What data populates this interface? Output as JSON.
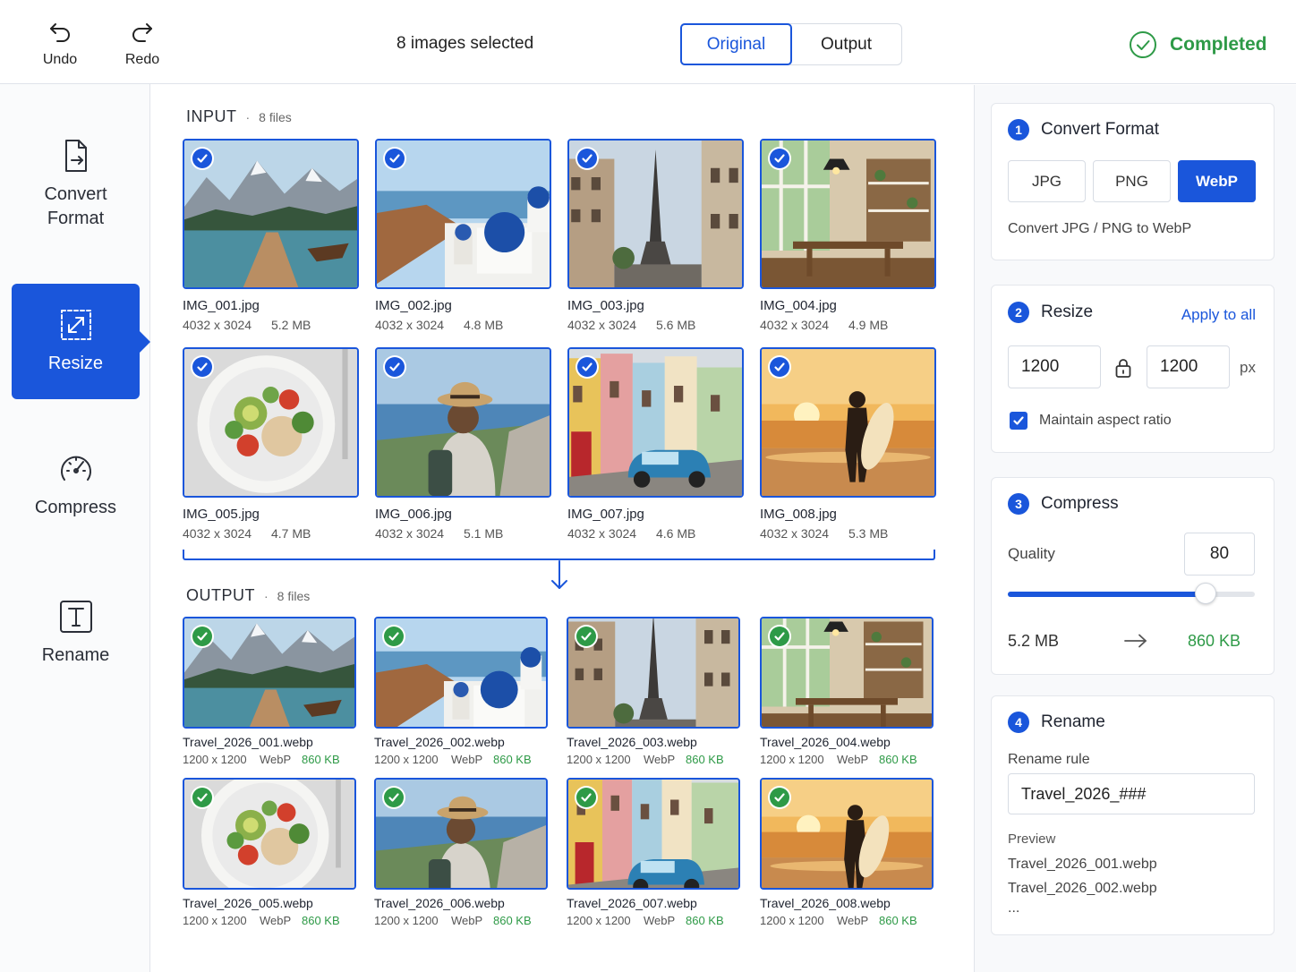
{
  "toolbar": {
    "undo_label": "Undo",
    "redo_label": "Redo",
    "selection_text": "8 images selected",
    "view_tabs": [
      "Original",
      "Output"
    ],
    "active_view": "Original",
    "status": "Completed"
  },
  "sidebar": {
    "items": [
      {
        "label": "Convert Format",
        "icon": "file-convert-icon"
      },
      {
        "label": "Resize",
        "icon": "resize-icon",
        "active": true
      },
      {
        "label": "Compress",
        "icon": "gauge-icon"
      },
      {
        "label": "Rename",
        "icon": "text-icon"
      }
    ]
  },
  "input": {
    "title": "INPUT",
    "count": "8 files",
    "files": [
      {
        "name": "IMG_001.jpg",
        "dims": "4032 x 3024",
        "size": "5.2 MB",
        "scene": "lake"
      },
      {
        "name": "IMG_002.jpg",
        "dims": "4032 x 3024",
        "size": "4.8 MB",
        "scene": "santorini"
      },
      {
        "name": "IMG_003.jpg",
        "dims": "4032 x 3024",
        "size": "5.6 MB",
        "scene": "paris"
      },
      {
        "name": "IMG_004.jpg",
        "dims": "4032 x 3024",
        "size": "4.9 MB",
        "scene": "cafe"
      },
      {
        "name": "IMG_005.jpg",
        "dims": "4032 x 3024",
        "size": "4.7 MB",
        "scene": "salad"
      },
      {
        "name": "IMG_006.jpg",
        "dims": "4032 x 3024",
        "size": "5.1 MB",
        "scene": "traveler"
      },
      {
        "name": "IMG_007.jpg",
        "dims": "4032 x 3024",
        "size": "4.6 MB",
        "scene": "street"
      },
      {
        "name": "IMG_008.jpg",
        "dims": "4032 x 3024",
        "size": "5.3 MB",
        "scene": "surfer"
      }
    ]
  },
  "output": {
    "title": "OUTPUT",
    "count": "8 files",
    "files": [
      {
        "name": "Travel_2026_001.webp",
        "dims": "1200 x 1200",
        "format": "WebP",
        "size": "860 KB",
        "scene": "lake"
      },
      {
        "name": "Travel_2026_002.webp",
        "dims": "1200 x 1200",
        "format": "WebP",
        "size": "860 KB",
        "scene": "santorini"
      },
      {
        "name": "Travel_2026_003.webp",
        "dims": "1200 x 1200",
        "format": "WebP",
        "size": "860 KB",
        "scene": "paris"
      },
      {
        "name": "Travel_2026_004.webp",
        "dims": "1200 x 1200",
        "format": "WebP",
        "size": "860 KB",
        "scene": "cafe"
      },
      {
        "name": "Travel_2026_005.webp",
        "dims": "1200 x 1200",
        "format": "WebP",
        "size": "860 KB",
        "scene": "salad"
      },
      {
        "name": "Travel_2026_006.webp",
        "dims": "1200 x 1200",
        "format": "WebP",
        "size": "860 KB",
        "scene": "traveler"
      },
      {
        "name": "Travel_2026_007.webp",
        "dims": "1200 x 1200",
        "format": "WebP",
        "size": "860 KB",
        "scene": "street"
      },
      {
        "name": "Travel_2026_008.webp",
        "dims": "1200 x 1200",
        "format": "WebP",
        "size": "860 KB",
        "scene": "surfer"
      }
    ]
  },
  "panel": {
    "convert": {
      "step": "1",
      "title": "Convert Format",
      "formats": [
        "JPG",
        "PNG",
        "WebP"
      ],
      "selected": "WebP",
      "description": "Convert JPG / PNG to WebP"
    },
    "resize": {
      "step": "2",
      "title": "Resize",
      "apply_all": "Apply to all",
      "width": "1200",
      "height": "1200",
      "unit": "px",
      "maintain_label": "Maintain aspect ratio",
      "maintain": true
    },
    "compress": {
      "step": "3",
      "title": "Compress",
      "quality_label": "Quality",
      "quality": "80",
      "quality_fraction": 0.8,
      "size_before": "5.2 MB",
      "size_after": "860 KB"
    },
    "rename": {
      "step": "4",
      "title": "Rename",
      "rule_label": "Rename rule",
      "rule": "Travel_2026_###",
      "preview_label": "Preview",
      "preview": [
        "Travel_2026_001.webp",
        "Travel_2026_002.webp"
      ],
      "ellipsis": "..."
    }
  },
  "colors": {
    "accent": "#1a56db",
    "success": "#2e9a47"
  }
}
